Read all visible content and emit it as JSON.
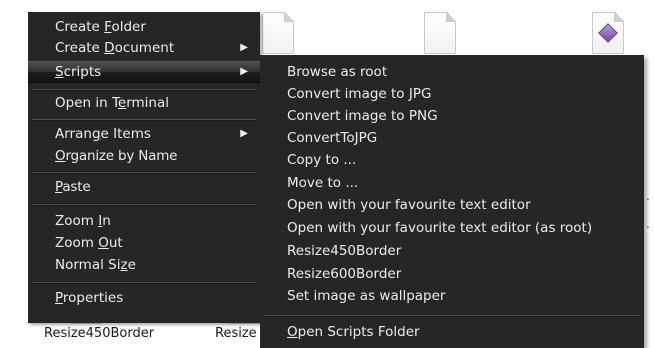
{
  "desktop": {
    "files": [
      {
        "label": "Resize450Border",
        "icon": "document-icon"
      },
      {
        "label": "Resize",
        "icon": "document-icon"
      }
    ],
    "icons": [
      "document-icon",
      "document-icon",
      "image-file-icon"
    ]
  },
  "main_menu": {
    "items": [
      {
        "pre": "Create ",
        "mnemonic": "F",
        "post": "older",
        "has_submenu": false
      },
      {
        "pre": "Create ",
        "mnemonic": "D",
        "post": "ocument",
        "has_submenu": true,
        "arrow": "▶"
      },
      {
        "pre": "",
        "mnemonic": "S",
        "post": "cripts",
        "has_submenu": true,
        "arrow": "▶",
        "highlighted": true
      },
      {
        "pre": "Open in T",
        "mnemonic": "e",
        "post": "rminal",
        "has_submenu": false
      },
      {
        "pre": "Arran",
        "mnemonic": "g",
        "post": "e Items",
        "has_submenu": true,
        "arrow": "▶"
      },
      {
        "pre": "",
        "mnemonic": "O",
        "post": "rganize by Name",
        "has_submenu": false
      },
      {
        "pre": "",
        "mnemonic": "P",
        "post": "aste",
        "has_submenu": false
      },
      {
        "pre": "Zoom ",
        "mnemonic": "I",
        "post": "n",
        "has_submenu": false
      },
      {
        "pre": "Zoom ",
        "mnemonic": "O",
        "post": "ut",
        "has_submenu": false
      },
      {
        "pre": "Normal Si",
        "mnemonic": "z",
        "post": "e",
        "has_submenu": false
      },
      {
        "pre": "",
        "mnemonic": "P",
        "post": "roperties",
        "has_submenu": false
      }
    ]
  },
  "scripts_submenu": {
    "items": [
      {
        "label": "Browse as root"
      },
      {
        "label": "Convert image to JPG"
      },
      {
        "label": "Convert image to PNG"
      },
      {
        "label": "ConvertToJPG"
      },
      {
        "label": "Copy to ..."
      },
      {
        "label": "Move to ..."
      },
      {
        "label": "Open with your favourite text editor"
      },
      {
        "label": "Open with your favourite text editor (as root)"
      },
      {
        "label": "Resize450Border"
      },
      {
        "label": "Resize600Border"
      },
      {
        "label": "Set image as wallpaper"
      }
    ],
    "footer": {
      "pre": "",
      "mnemonic": "O",
      "post": "pen Scripts Folder"
    }
  },
  "colors": {
    "menu_bg": "#262626",
    "menu_text": "#ececec",
    "highlight_top": "#4d4d4d",
    "highlight_bottom": "#141414",
    "desktop_bg": "#ffffff"
  }
}
